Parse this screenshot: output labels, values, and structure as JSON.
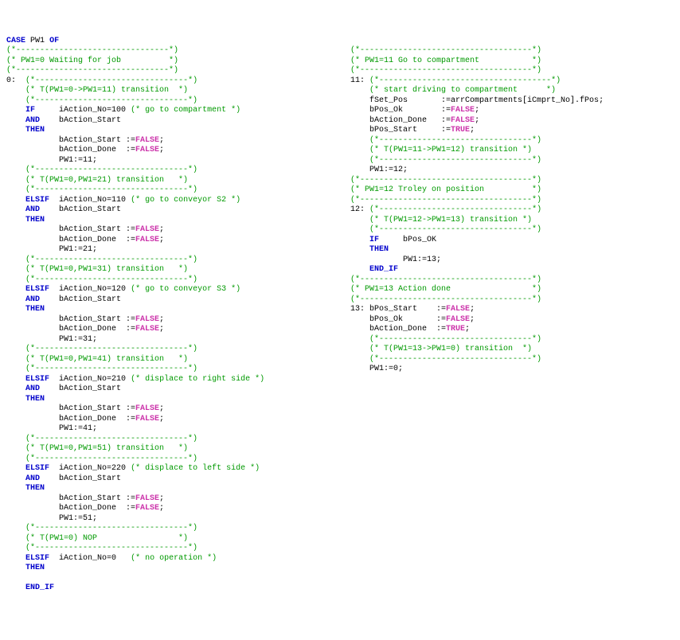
{
  "case_header": {
    "case": "CASE",
    "var": "PW1",
    "of": "OF"
  },
  "c0": {
    "sep": "(*--------------------------------*)",
    "pw10_wait_header": "(* PW1=0 Waiting for job          *)",
    "lbl0": "0:",
    "t_pw10_11": "(* T(PW1=0->PW1=11) transition  *)",
    "k_if": "IF",
    "k_and": "AND",
    "k_then": "THEN",
    "iact100": "iAction_No=100",
    "cmt_go_comp": "(* go to compartment *)",
    "bact_start": "bAction_Start",
    "bact_start_q": "bAction_Start :=",
    "bact_done_q": "bAction_Done  :=",
    "v_false": "FALSE",
    "sc": ";",
    "pw1_11": "PW1:=11;",
    "t_pw10_21": "(* T(PW1=0,PW1=21) transition   *)",
    "k_elsif": "ELSIF",
    "iact110": "iAction_No=110",
    "cmt_go_s2": "(* go to conveyor S2 *)",
    "pw1_21": "PW1:=21;",
    "t_pw10_31": "(* T(PW1=0,PW1=31) transition   *)",
    "iact120": "iAction_No=120",
    "cmt_go_s3": "(* go to conveyor S3 *)",
    "pw1_31": "PW1:=31;",
    "t_pw10_41": "(* T(PW1=0,PW1=41) transition   *)",
    "iact210": "iAction_No=210",
    "cmt_disp_r": "(* displace to right side *)",
    "pw1_41": "PW1:=41;",
    "t_pw10_51": "(* T(PW1=0,PW1=51) transition   *)",
    "iact220": "iAction_No=220",
    "cmt_disp_l": "(* displace to left side *)",
    "pw1_51": "PW1:=51;",
    "t_pw10_nop": "(* T(PW1=0) NOP                 *)",
    "iact0": "iAction_No=0",
    "cmt_noop": "(* no operation *)",
    "k_endif": "END_IF"
  },
  "c1": {
    "sep11": "(*------------------------------------*)",
    "pw11_header": "(* PW1=11 Go to compartment           *)",
    "lbl11": "11:",
    "cmt_start_drive": "(* start driving to compartment      *)",
    "fset": "fSet_Pos       :=arrCompartments[iCmprt_No].fPos;",
    "bpos_ok": "bPos_Ok        :=",
    "v_false": "FALSE",
    "sc": ";",
    "bact_done": "bAction_Done   :=",
    "bpos_start": "bPos_Start     :=",
    "v_true": "TRUE",
    "t_11_12": "(* T(PW1=11->PW1=12) transition *)",
    "pw1_12": "PW1:=12;",
    "pw12_header": "(* PW1=12 Troley on position          *)",
    "lbl12": "12:",
    "t_12_13": "(* T(PW1=12->PW1=13) transition *)",
    "k_if": "IF",
    "bpos_ok_chk": "bPos_OK",
    "k_then": "THEN",
    "pw1_13": "PW1:=13;",
    "k_endif": "END_IF",
    "pw13_header": "(* PW1=13 Action done                 *)",
    "lbl13": "13:",
    "bpos_start13": "bPos_Start    :=",
    "bpos_ok13": "bPos_Ok       :=",
    "bact_done13": "bAction_Done  :=",
    "t_13_0": "(* T(PW1=13->PW1=0) transition  *)",
    "pw1_0": "PW1:=0;"
  }
}
